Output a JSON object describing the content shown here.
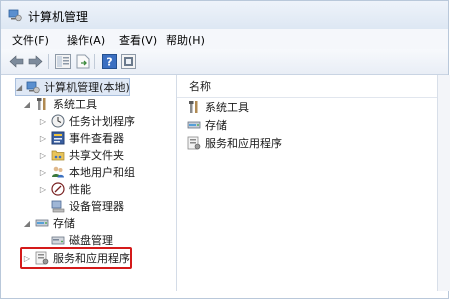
{
  "window": {
    "title": "计算机管理"
  },
  "menubar": {
    "items": [
      "文件(F)",
      "操作(A)",
      "查看(V)",
      "帮助(H)"
    ]
  },
  "toolbar": {
    "buttons": [
      "back-arrow-icon",
      "forward-arrow-icon",
      "show-hide-tree-icon",
      "export-list-icon",
      "help-icon",
      "properties-icon"
    ]
  },
  "tree": {
    "root": "计算机管理(本地)",
    "system_tools": {
      "label": "系统工具",
      "children": [
        "任务计划程序",
        "事件查看器",
        "共享文件夹",
        "本地用户和组",
        "性能",
        "设备管理器"
      ]
    },
    "storage": {
      "label": "存储",
      "children": [
        "磁盘管理"
      ]
    },
    "services": {
      "label": "服务和应用程序"
    }
  },
  "list": {
    "header": "名称",
    "items": [
      "系统工具",
      "存储",
      "服务和应用程序"
    ]
  },
  "colors": {
    "highlight_box": "#d41a1a",
    "selection": "#dfe8f5"
  }
}
